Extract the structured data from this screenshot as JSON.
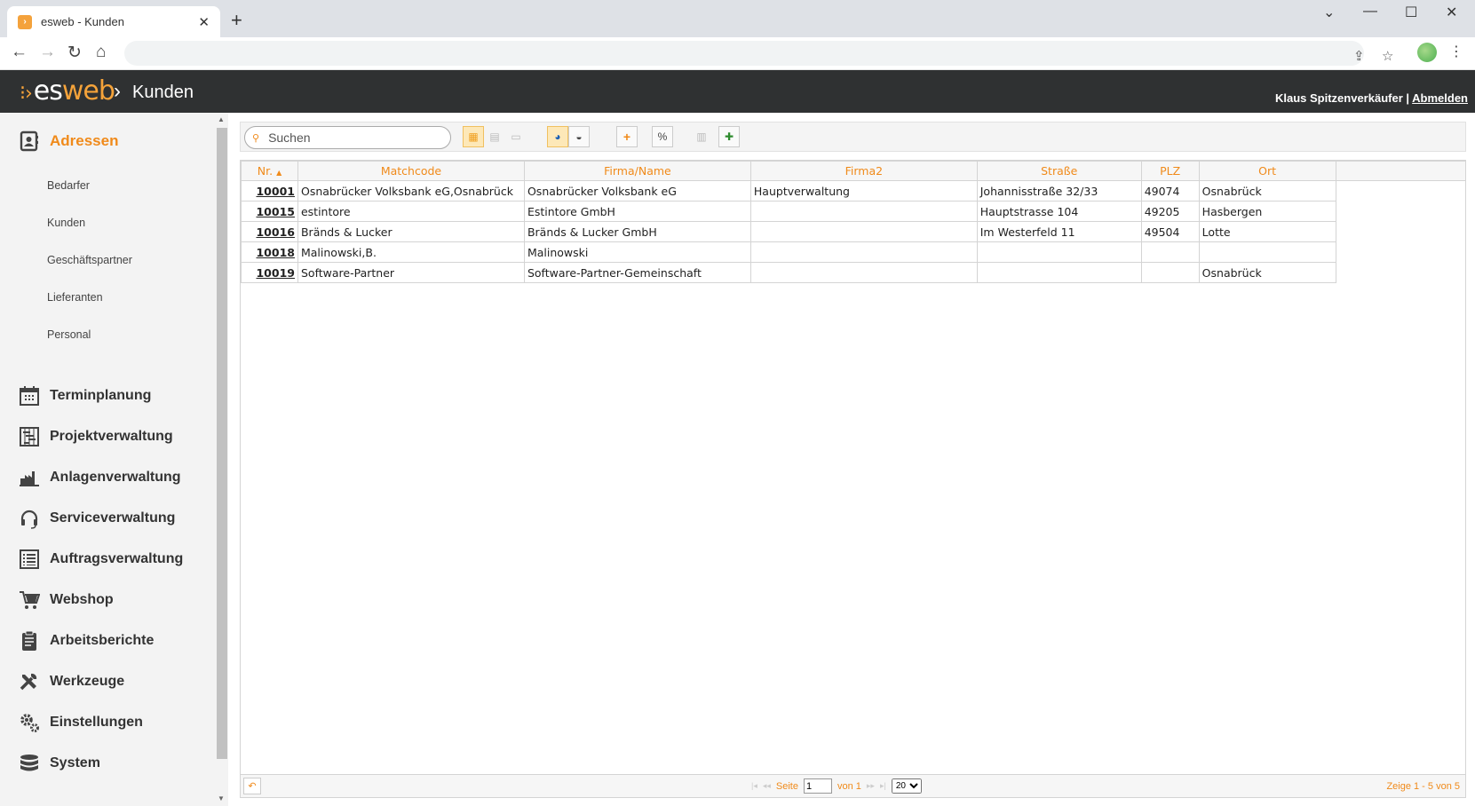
{
  "browser": {
    "tab_title": "esweb - Kunden",
    "tab_favicon": "esweb-favicon",
    "new_tab": "+",
    "win_minimize": "⌄",
    "address": ""
  },
  "app": {
    "logo_es": "es",
    "logo_web": "web",
    "breadcrumb_sep": "›",
    "breadcrumb": "Kunden",
    "user": "Klaus Spitzenverkäufer",
    "user_sep": " | ",
    "logout": "Abmelden",
    "accent_color": "#f08a1a",
    "header_color": "#2f3132"
  },
  "sidebar": {
    "active": {
      "label": "Adressen",
      "icon": "address-book-icon"
    },
    "subitems": [
      "Bedarfer",
      "Kunden",
      "Geschäftspartner",
      "Lieferanten",
      "Personal"
    ],
    "items": [
      {
        "label": "Terminplanung",
        "icon": "calendar-icon"
      },
      {
        "label": "Projektverwaltung",
        "icon": "gantt-icon"
      },
      {
        "label": "Anlagenverwaltung",
        "icon": "factory-icon"
      },
      {
        "label": "Serviceverwaltung",
        "icon": "headset-icon"
      },
      {
        "label": "Auftragsverwaltung",
        "icon": "list-icon"
      },
      {
        "label": "Webshop",
        "icon": "cart-icon"
      },
      {
        "label": "Arbeitsberichte",
        "icon": "clipboard-icon"
      },
      {
        "label": "Werkzeuge",
        "icon": "tools-icon"
      },
      {
        "label": "Einstellungen",
        "icon": "gears-icon"
      },
      {
        "label": "System",
        "icon": "database-icon"
      }
    ]
  },
  "toolbar": {
    "search_placeholder": "Suchen"
  },
  "table": {
    "columns": [
      "Nr.",
      "Matchcode",
      "Firma/Name",
      "Firma2",
      "Straße",
      "PLZ",
      "Ort"
    ],
    "rows": [
      [
        "10001",
        "Osnabrücker Volksbank eG,Osnabrück",
        "Osnabrücker Volksbank eG",
        "Hauptverwaltung",
        "Johannisstraße 32/33",
        "49074",
        "Osnabrück"
      ],
      [
        "10015",
        "estintore",
        "Estintore GmbH",
        "",
        "Hauptstrasse 104",
        "49205",
        "Hasbergen"
      ],
      [
        "10016",
        "Bränds & Lucker",
        "Bränds & Lucker GmbH",
        "",
        "Im Westerfeld 11",
        "49504",
        "Lotte"
      ],
      [
        "10018",
        "Malinowski,B.",
        "Malinowski",
        "",
        "",
        "",
        ""
      ],
      [
        "10019",
        "Software-Partner",
        "Software-Partner-Gemeinschaft",
        "",
        "",
        "",
        "Osnabrück"
      ]
    ]
  },
  "pager": {
    "page_label": "Seite",
    "page_value": "1",
    "of_label": "von 1",
    "page_size": "20",
    "showing": "Zeige 1 - 5 von 5"
  }
}
